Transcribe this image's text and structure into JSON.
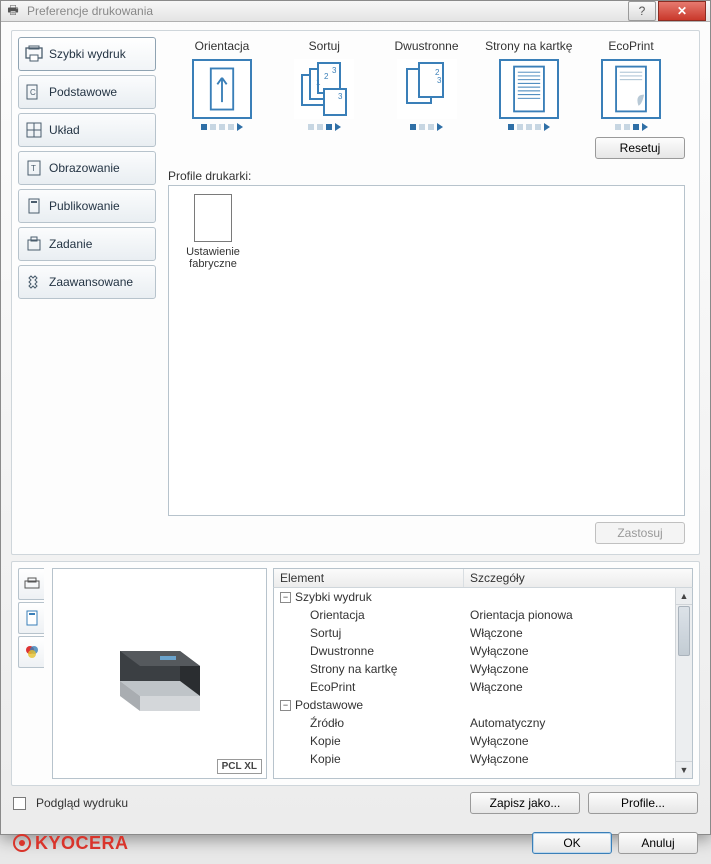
{
  "window": {
    "title": "Preferencje drukowania"
  },
  "sidebar": {
    "items": [
      {
        "label": "Szybki wydruk"
      },
      {
        "label": "Podstawowe"
      },
      {
        "label": "Układ"
      },
      {
        "label": "Obrazowanie"
      },
      {
        "label": "Publikowanie"
      },
      {
        "label": "Zadanie"
      },
      {
        "label": "Zaawansowane"
      }
    ]
  },
  "quick_options": {
    "orientation": "Orientacja",
    "collate": "Sortuj",
    "duplex": "Dwustronne",
    "pages_per_sheet": "Strony na kartkę",
    "ecoprint": "EcoPrint"
  },
  "buttons": {
    "reset": "Resetuj",
    "apply": "Zastosuj",
    "save_as": "Zapisz jako...",
    "profiles": "Profile...",
    "ok": "OK",
    "cancel": "Anuluj"
  },
  "profiles": {
    "label": "Profile drukarki:",
    "items": [
      {
        "name": "Ustawienie fabryczne"
      }
    ]
  },
  "preview": {
    "mode_badge": "PCL XL",
    "checkbox_label": "Podgląd wydruku"
  },
  "details": {
    "header_element": "Element",
    "header_details": "Szczegóły",
    "rows": [
      {
        "type": "group",
        "label": "Szybki wydruk"
      },
      {
        "type": "child",
        "label": "Orientacja",
        "value": "Orientacja pionowa"
      },
      {
        "type": "child",
        "label": "Sortuj",
        "value": "Włączone"
      },
      {
        "type": "child",
        "label": "Dwustronne",
        "value": "Wyłączone"
      },
      {
        "type": "child",
        "label": "Strony na kartkę",
        "value": "Wyłączone"
      },
      {
        "type": "child",
        "label": "EcoPrint",
        "value": "Włączone"
      },
      {
        "type": "group",
        "label": "Podstawowe"
      },
      {
        "type": "child",
        "label": "Źródło",
        "value": "Automatyczny"
      },
      {
        "type": "child",
        "label": "Kopie",
        "value": "Wyłączone"
      },
      {
        "type": "child",
        "label": "Kopie",
        "value": "Wyłączone"
      }
    ]
  },
  "brand": {
    "name": "KYOCERA"
  }
}
